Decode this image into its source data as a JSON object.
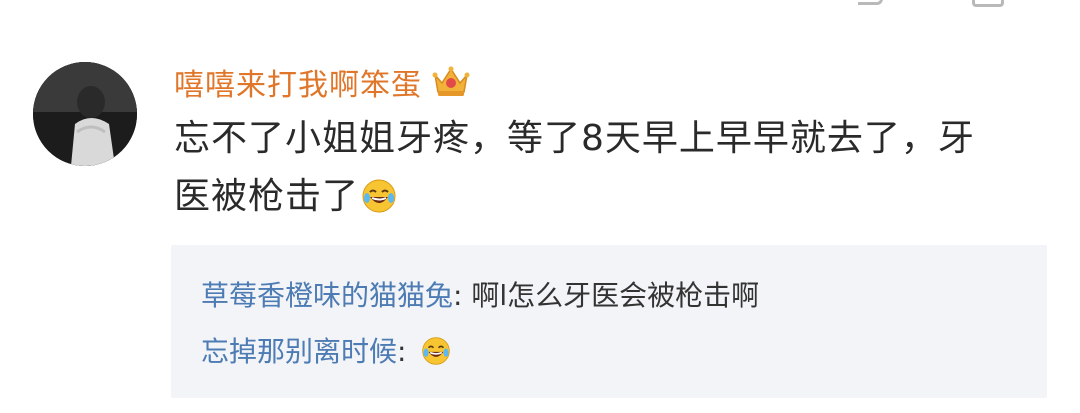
{
  "top_actions": {
    "icons": [
      "comment-icon",
      "like-icon"
    ]
  },
  "comment": {
    "avatar": "avatar-photo",
    "username": "嘻嘻来打我啊笨蛋",
    "badge_icon": "crown-badge-icon",
    "text_line1": "忘不了小姐姐牙疼，等了8天早上早早就去了，牙",
    "text_line2": "医被枪击了",
    "emoji": "laugh-cry-emoji"
  },
  "replies": [
    {
      "name": "草莓香橙味的猫猫兔",
      "separator": ": ",
      "text": "啊l怎么牙医会被枪击啊",
      "emoji": ""
    },
    {
      "name": "忘掉那别离时候",
      "separator": ": ",
      "text": "",
      "emoji": "laugh-cry-emoji"
    }
  ],
  "colors": {
    "username": "#e0762a",
    "reply_name": "#4d7bb3",
    "reply_bg": "#f2f4f7",
    "text": "#2a2a2a"
  }
}
